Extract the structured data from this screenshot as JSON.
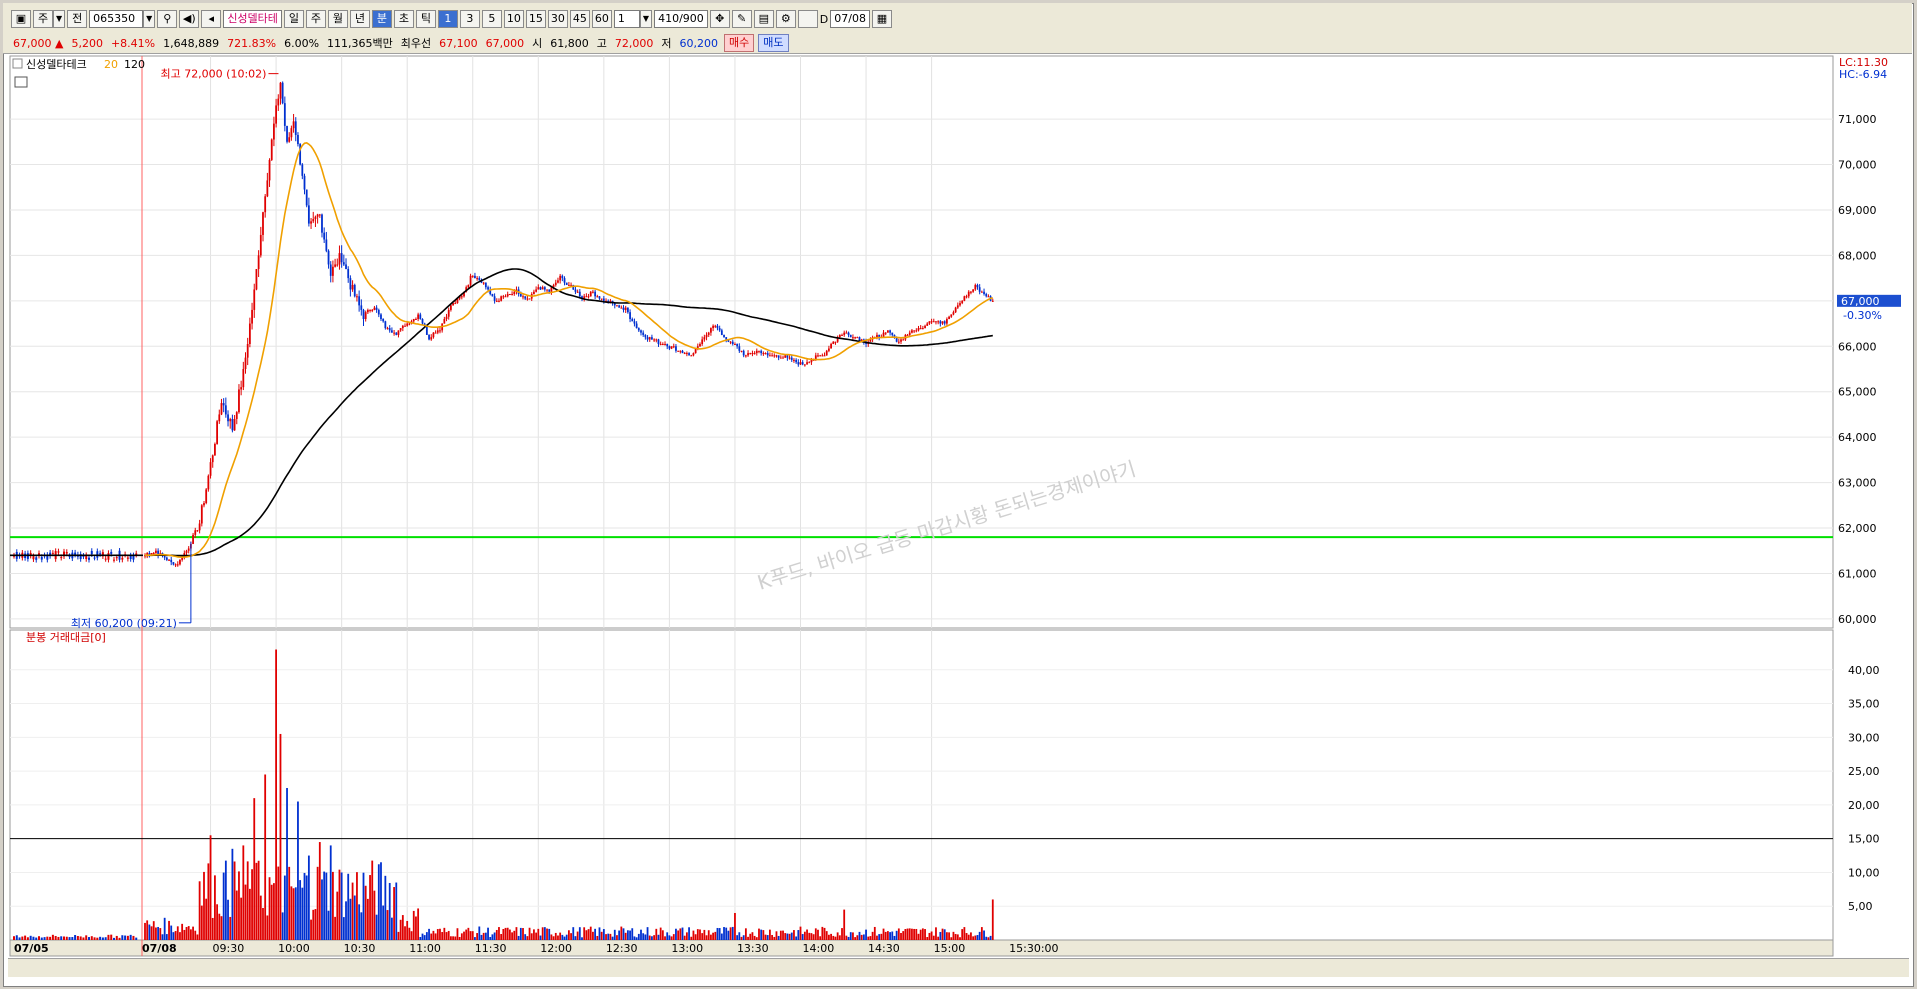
{
  "toolbar": {
    "market_label": "주",
    "period_label": "전",
    "code": "065350",
    "stock_name": "신성델타테",
    "timeframe_buttons": [
      "일",
      "주",
      "월",
      "년",
      "분",
      "초",
      "틱"
    ],
    "timeframe_active": "분",
    "interval_buttons": [
      "1",
      "3",
      "5",
      "10",
      "15",
      "30",
      "45",
      "60"
    ],
    "interval_active": "1",
    "unit_value": "1",
    "count": "410/900",
    "date": "07/08",
    "d_label": "D"
  },
  "quote": {
    "price": "67,000",
    "arrow": "▲",
    "change": "5,200",
    "change_pct": "+8.41%",
    "volume": "1,648,889",
    "vol_ratio": "721.83%",
    "turnover": "6.00%",
    "amount": "111,365백만",
    "best_label": "최우선",
    "best_ask": "67,100",
    "best_bid": "67,000",
    "open_label": "시",
    "open": "61,800",
    "high_label": "고",
    "high": "72,000",
    "low_label": "저",
    "low": "60,200",
    "buy_label": "매수",
    "sell_label": "매도"
  },
  "price_panel": {
    "stock_legend": "신성델타테크",
    "ma_short_label": "20",
    "ma_long_label": "120",
    "lc_label": "LC:11.30",
    "hc_label": "HC:-6.94",
    "current_price_tag": "67,000",
    "current_pct_tag": "-0.30%",
    "high_annotation": "최고 72,000 (10:02)",
    "low_annotation": "최저 60,200 (09:21)",
    "watermark": "K푸드, 바이오 급등 마감시황 돈되는경제이야기"
  },
  "volume_panel": {
    "legend": "분봉 거래대금[0]"
  },
  "x_axis": {
    "labels": [
      "07/05",
      "07/08",
      "09:30",
      "10:00",
      "10:30",
      "11:00",
      "11:30",
      "12:00",
      "12:30",
      "13:00",
      "13:30",
      "14:00",
      "14:30",
      "15:00",
      "15:30:00"
    ]
  },
  "colors": {
    "up": "#e00000",
    "down": "#0030d0",
    "ma20": "#f0a000",
    "ma120": "#000000",
    "ref_line": "#00e000",
    "vol_ref_line": "#000000"
  },
  "chart_data": {
    "type": "candlestick",
    "price_axis": {
      "ticks": [
        "60,000",
        "61,000",
        "62,000",
        "63,000",
        "64,000",
        "65,000",
        "66,000",
        "67,000",
        "68,000",
        "69,000",
        "70,000",
        "71,000"
      ],
      "range": [
        59800,
        72300
      ]
    },
    "volume_axis": {
      "ticks": [
        "5,00",
        "10,00",
        "15,00",
        "20,00",
        "25,00",
        "30,00",
        "35,00",
        "40,00"
      ],
      "range": [
        0,
        45
      ]
    },
    "reference_price_line": 61800,
    "volume_reference_line": 15,
    "price_anchors": [
      [
        "09:00",
        61400
      ],
      [
        "09:05",
        61500
      ],
      [
        "09:10",
        61300
      ],
      [
        "09:15",
        61200
      ],
      [
        "09:20",
        61600
      ],
      [
        "09:25",
        62100
      ],
      [
        "09:30",
        63400
      ],
      [
        "09:35",
        64800
      ],
      [
        "09:40",
        64200
      ],
      [
        "09:45",
        65400
      ],
      [
        "09:50",
        67200
      ],
      [
        "09:55",
        69400
      ],
      [
        "10:00",
        71200
      ],
      [
        "10:02",
        71800
      ],
      [
        "10:05",
        70400
      ],
      [
        "10:08",
        71000
      ],
      [
        "10:12",
        69800
      ],
      [
        "10:15",
        68600
      ],
      [
        "10:20",
        68900
      ],
      [
        "10:25",
        67600
      ],
      [
        "10:30",
        68000
      ],
      [
        "10:35",
        67200
      ],
      [
        "10:40",
        66700
      ],
      [
        "10:45",
        66900
      ],
      [
        "10:50",
        66400
      ],
      [
        "10:55",
        66300
      ],
      [
        "11:00",
        66500
      ],
      [
        "11:05",
        66700
      ],
      [
        "11:10",
        66200
      ],
      [
        "11:15",
        66400
      ],
      [
        "11:20",
        66900
      ],
      [
        "11:25",
        67100
      ],
      [
        "11:30",
        67600
      ],
      [
        "11:35",
        67400
      ],
      [
        "11:40",
        67000
      ],
      [
        "11:45",
        67100
      ],
      [
        "11:50",
        67200
      ],
      [
        "11:55",
        67000
      ],
      [
        "12:00",
        67300
      ],
      [
        "12:05",
        67200
      ],
      [
        "12:10",
        67500
      ],
      [
        "12:15",
        67300
      ],
      [
        "12:20",
        67100
      ],
      [
        "12:25",
        67200
      ],
      [
        "12:30",
        67000
      ],
      [
        "12:35",
        66900
      ],
      [
        "12:40",
        66800
      ],
      [
        "12:45",
        66400
      ],
      [
        "12:50",
        66200
      ],
      [
        "12:55",
        66100
      ],
      [
        "13:00",
        66000
      ],
      [
        "13:05",
        65900
      ],
      [
        "13:10",
        65800
      ],
      [
        "13:15",
        66100
      ],
      [
        "13:20",
        66500
      ],
      [
        "13:25",
        66200
      ],
      [
        "13:30",
        66000
      ],
      [
        "13:35",
        65800
      ],
      [
        "13:40",
        65900
      ],
      [
        "13:45",
        65800
      ],
      [
        "13:50",
        65800
      ],
      [
        "13:55",
        65700
      ],
      [
        "14:00",
        65600
      ],
      [
        "14:05",
        65700
      ],
      [
        "14:10",
        65800
      ],
      [
        "14:15",
        66100
      ],
      [
        "14:20",
        66300
      ],
      [
        "14:25",
        66200
      ],
      [
        "14:30",
        66100
      ],
      [
        "14:35",
        66200
      ],
      [
        "14:40",
        66300
      ],
      [
        "14:45",
        66100
      ],
      [
        "14:50",
        66300
      ],
      [
        "14:55",
        66400
      ],
      [
        "15:00",
        66600
      ],
      [
        "15:05",
        66500
      ],
      [
        "15:10",
        66800
      ],
      [
        "15:15",
        67100
      ],
      [
        "15:20",
        67300
      ],
      [
        "15:25",
        67100
      ],
      [
        "15:28",
        67000
      ]
    ],
    "prior_day": {
      "label": "07/05",
      "close": 61400
    },
    "session_high": {
      "price": 72000,
      "time": "10:02"
    },
    "session_low": {
      "price": 60200,
      "time": "09:21"
    },
    "volume_peaks": [
      [
        "09:30",
        15.5
      ],
      [
        "09:40",
        13.5
      ],
      [
        "09:45",
        14.0
      ],
      [
        "09:50",
        21.0
      ],
      [
        "09:55",
        24.5
      ],
      [
        "10:00",
        43.0
      ],
      [
        "10:02",
        30.5
      ],
      [
        "10:05",
        22.5
      ],
      [
        "10:10",
        20.5
      ],
      [
        "10:15",
        12.5
      ],
      [
        "10:20",
        14.5
      ],
      [
        "10:25",
        14.0
      ],
      [
        "10:35",
        8.5
      ],
      [
        "10:50",
        9.5
      ],
      [
        "13:30",
        4.0
      ],
      [
        "14:20",
        4.5
      ],
      [
        "15:28",
        6.0
      ]
    ]
  }
}
